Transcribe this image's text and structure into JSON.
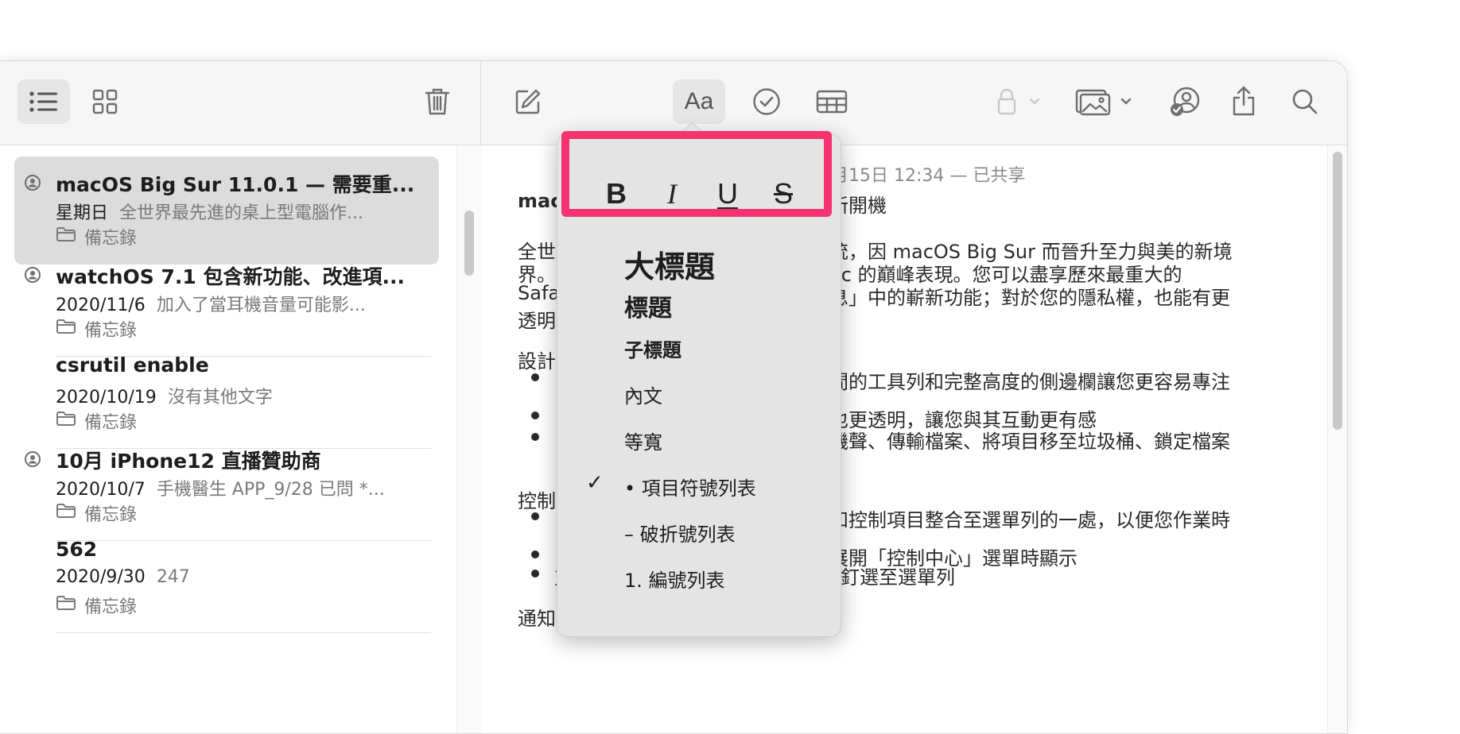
{
  "toolbar": {
    "left_icons": [
      "list-view-icon",
      "gallery-view-icon",
      "trash-icon"
    ],
    "right_icons": [
      "compose-icon",
      "format-aa-icon",
      "checklist-icon",
      "table-icon",
      "lock-icon",
      "media-icon",
      "collaborate-icon",
      "share-icon",
      "search-icon"
    ],
    "format_label": "Aa",
    "accent_color": "#f5336e"
  },
  "notes": [
    {
      "title": "macOS Big Sur 11.0.1 — 需要重...",
      "date": "星期日",
      "preview": "全世界最先進的桌上型電腦作...",
      "folder": "備忘錄",
      "shared": true,
      "selected": true
    },
    {
      "title": "watchOS 7.1 包含新功能、改進項...",
      "date": "2020/11/6",
      "preview": "加入了當耳機音量可能影...",
      "folder": "備忘錄",
      "shared": true,
      "selected": false
    },
    {
      "title": "csrutil enable",
      "date": "2020/10/19",
      "preview": "沒有其他文字",
      "folder": "備忘錄",
      "shared": false,
      "selected": false
    },
    {
      "title": "10月 iPhone12 直播贊助商",
      "date": "2020/10/7",
      "preview": "手機醫生 APP_9/28 已問 *...",
      "folder": "備忘錄",
      "shared": true,
      "selected": false
    },
    {
      "title": "562",
      "date": "2020/9/30",
      "preview": "247",
      "folder": "備忘錄",
      "shared": false,
      "selected": false
    }
  ],
  "editor": {
    "meta": "月15日 12:34 — 已共享",
    "title_left": "mac",
    "title_right": "新開機",
    "lines": [
      {
        "left": "全世",
        "right": "統，因 macOS Big Sur 而晉升至力與美的新境"
      },
      {
        "left": "界。",
        "right": "ac 的巔峰表現。您可以盡享歷來最重大的"
      },
      {
        "left": "Safa",
        "right": "息」中的嶄新功能；對於您的隱私權，也能有更"
      },
      {
        "left": "透明",
        "right": ""
      }
    ],
    "section1": "設計",
    "bullets1": [
      "間的工具列和完整高度的側邊欄讓您更容易專注",
      "也更透明，讓您與其互動更有感",
      "機聲、傳輸檔案、將項目移至垃圾桶、鎖定檔案"
    ],
    "section2": "控制",
    "bullets2": [
      "和控制項目整合至選單列的一處，以便您作業時",
      "展開「控制中心」選單時顯示",
      "支援從「控制中心」將喜愛的選單釘選至選單列"
    ],
    "section3": "通知中心"
  },
  "popover": {
    "format_buttons": [
      "B",
      "I",
      "U",
      "S"
    ],
    "styles": [
      {
        "label": "大標題",
        "checked": false
      },
      {
        "label": "標題",
        "checked": false
      },
      {
        "label": "子標題",
        "checked": false
      },
      {
        "label": "內文",
        "checked": false
      },
      {
        "label": "等寬",
        "checked": false
      },
      {
        "label": "• 項目符號列表",
        "checked": true
      },
      {
        "label": "– 破折號列表",
        "checked": false
      },
      {
        "label": "1. 編號列表",
        "checked": false
      }
    ],
    "check_mark": "✓"
  }
}
